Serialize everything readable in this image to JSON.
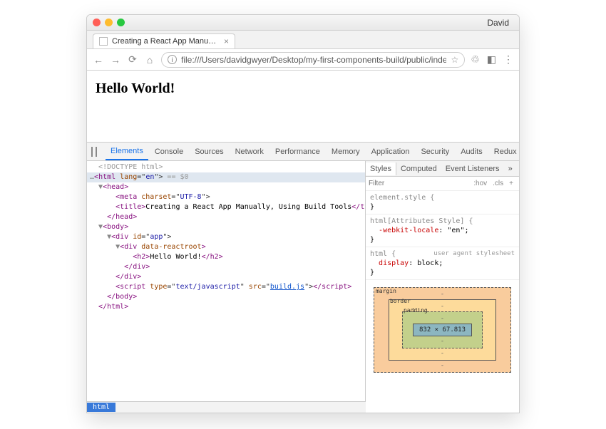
{
  "titlebar": {
    "user": "David"
  },
  "tab": {
    "title": "Creating a React App Manually",
    "close": "×"
  },
  "toolbar": {
    "url": "file:///Users/davidgwyer/Desktop/my-first-components-build/public/index.html",
    "info": "i"
  },
  "page": {
    "heading": "Hello World!"
  },
  "devtools": {
    "tabs": [
      "Elements",
      "Console",
      "Sources",
      "Network",
      "Performance",
      "Memory",
      "Application",
      "Security",
      "Audits",
      "Redux"
    ],
    "close": "×",
    "more": "⋮"
  },
  "dom": {
    "l0": "<!DOCTYPE html>",
    "l1a": "<",
    "l1b": "html",
    "l1c": " lang",
    "l1d": "=\"",
    "l1e": "en",
    "l1f": "\">",
    "l1g": " == $0",
    "l2a": "<",
    "l2b": "head",
    "l2c": ">",
    "l3a": "<",
    "l3b": "meta",
    "l3c": " charset",
    "l3d": "=\"",
    "l3e": "UTF-8",
    "l3f": "\">",
    "l4a": "<",
    "l4b": "title",
    "l4c": ">",
    "l4d": "Creating a React App Manually, Using Build Tools",
    "l4e": "</",
    "l4f": "title",
    "l4g": ">",
    "l5a": "</",
    "l5b": "head",
    "l5c": ">",
    "l6a": "<",
    "l6b": "body",
    "l6c": ">",
    "l7a": "<",
    "l7b": "div",
    "l7c": " id",
    "l7d": "=\"",
    "l7e": "app",
    "l7f": "\">",
    "l8a": "<",
    "l8b": "div",
    "l8c": " data-reactroot",
    "l8d": ">",
    "l9a": "<",
    "l9b": "h2",
    "l9c": ">",
    "l9d": "Hello World!",
    "l9e": "</",
    "l9f": "h2",
    "l9g": ">",
    "l10a": "</",
    "l10b": "div",
    "l10c": ">",
    "l11a": "</",
    "l11b": "div",
    "l11c": ">",
    "l12a": "<",
    "l12b": "script",
    "l12c": " type",
    "l12d": "=\"",
    "l12e": "text/javascript",
    "l12f": "\" ",
    "l12g": "src",
    "l12h": "=\"",
    "l12i": "build.js",
    "l12j": "\">",
    "l12k": "</",
    "l12l": "script",
    "l12m": ">",
    "l13a": "</",
    "l13b": "body",
    "l13c": ">",
    "l14a": "</",
    "l14b": "html",
    "l14c": ">"
  },
  "crumb": "html",
  "stylesTabs": [
    "Styles",
    "Computed",
    "Event Listeners"
  ],
  "stylesMore": "»",
  "filter": {
    "placeholder": "Filter",
    "hov": ":hov",
    "cls": ".cls",
    "plus": "+"
  },
  "rules": {
    "r1sel": "element.style {",
    "r1end": "}",
    "r2sel": "html[Attributes Style] {",
    "r2p": "-webkit-locale",
    "r2v": ": \"en\";",
    "r2end": "}",
    "r3sel": "html {",
    "r3src": "user agent stylesheet",
    "r3p": "display",
    "r3v": ": block;",
    "r3end": "}"
  },
  "boxmodel": {
    "margin": "margin",
    "border": "border",
    "padding": "padding",
    "content": "832 × 67.813",
    "dash": "-"
  }
}
